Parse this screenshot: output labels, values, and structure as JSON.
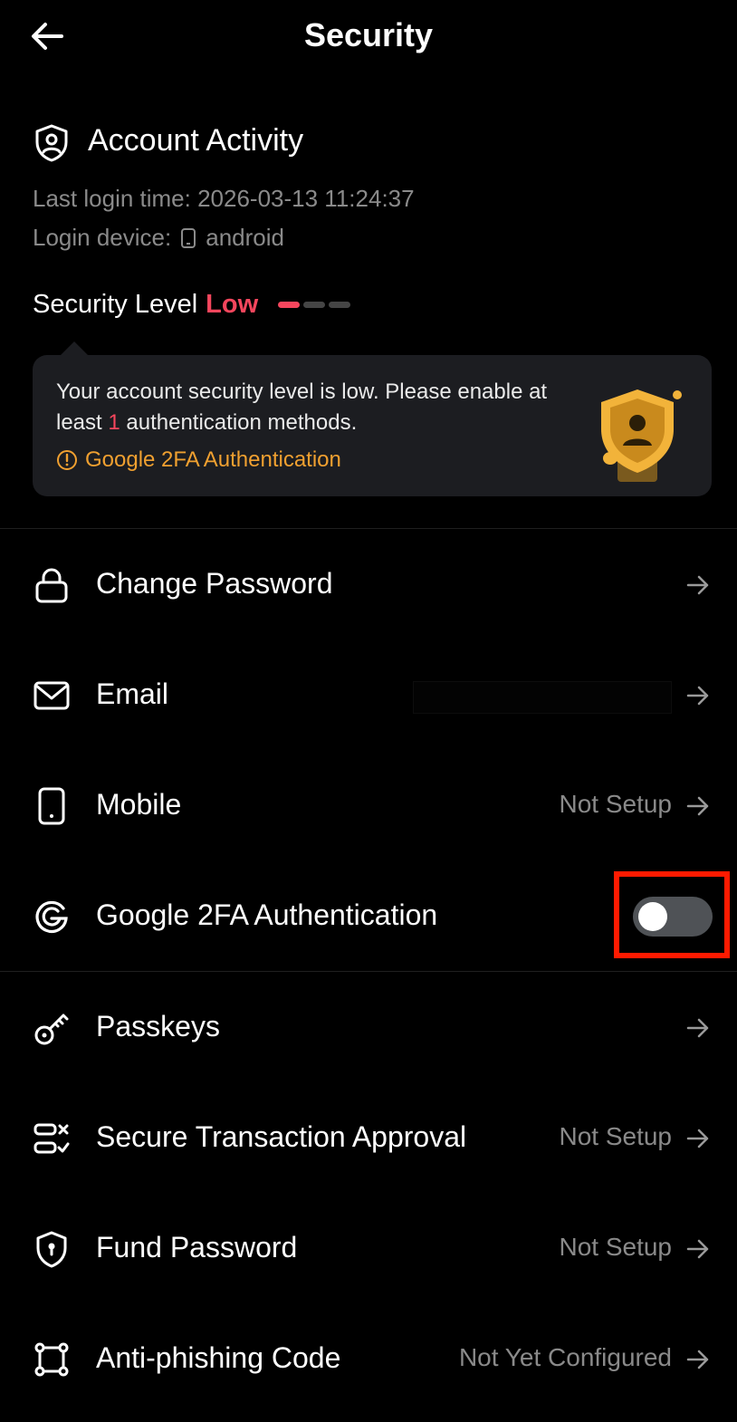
{
  "header": {
    "title": "Security",
    "back_icon": "arrow-left-icon"
  },
  "account_activity": {
    "title": "Account Activity",
    "icon": "user-shield-icon",
    "last_login_label": "Last login time: 2026-03-13 11:24:37",
    "login_device_label": "Login device:",
    "login_device_value": "android"
  },
  "security_level": {
    "label": "Security Level",
    "value": "Low",
    "level": 1,
    "max_level": 3,
    "color": "#f6465d"
  },
  "callout": {
    "message_part1": "Your account security level is low. Please enable at least ",
    "message_count": "1",
    "message_part2": " authentication methods.",
    "link_label": "Google 2FA Authentication",
    "link_color": "#f0a030"
  },
  "rows": {
    "change_password": {
      "label": "Change Password",
      "status": ""
    },
    "email": {
      "label": "Email",
      "status": ""
    },
    "mobile": {
      "label": "Mobile",
      "status": "Not Setup"
    },
    "google_2fa": {
      "label": "Google 2FA Authentication",
      "enabled": false
    },
    "passkeys": {
      "label": "Passkeys",
      "status": ""
    },
    "secure_tx": {
      "label": "Secure Transaction Approval",
      "status": "Not Setup"
    },
    "fund_password": {
      "label": "Fund Password",
      "status": "Not Setup"
    },
    "anti_phishing": {
      "label": "Anti-phishing Code",
      "status": "Not Yet Configured"
    }
  },
  "colors": {
    "background": "#000000",
    "card": "#1c1d21",
    "muted": "#8a8a8a",
    "highlight": "#ff1a00"
  }
}
